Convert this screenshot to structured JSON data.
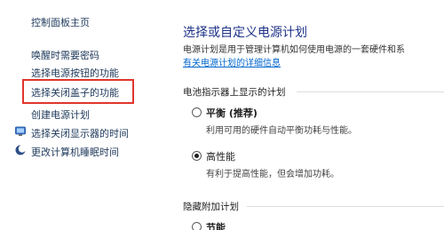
{
  "sidebar": {
    "home": "控制面板主页",
    "links": [
      "唤醒时需要密码",
      "选择电源按钮的功能",
      "选择关闭盖子的功能",
      "创建电源计划"
    ],
    "icon_links": [
      {
        "label": "选择关闭显示器的时间",
        "icon": "display-power-icon"
      },
      {
        "label": "更改计算机睡眠时间",
        "icon": "moon-sleep-icon"
      }
    ],
    "highlight_color": "#e0362c"
  },
  "main": {
    "title": "选择或自定义电源计划",
    "description": "电源计划是用于管理计算机如何使用电源的一套硬件和系",
    "more_link": "有关电源计划的详细信息",
    "battery_section": "电池指示器上显示的计划",
    "plans": [
      {
        "name": "平衡 (推荐)",
        "desc": "利用可用的硬件自动平衡功耗与性能。",
        "selected": false
      },
      {
        "name": "高性能",
        "desc": "有利于提高性能，但会增加功耗。",
        "selected": true
      }
    ],
    "hidden_section": "隐藏附加计划",
    "extra_plan": "节能"
  }
}
